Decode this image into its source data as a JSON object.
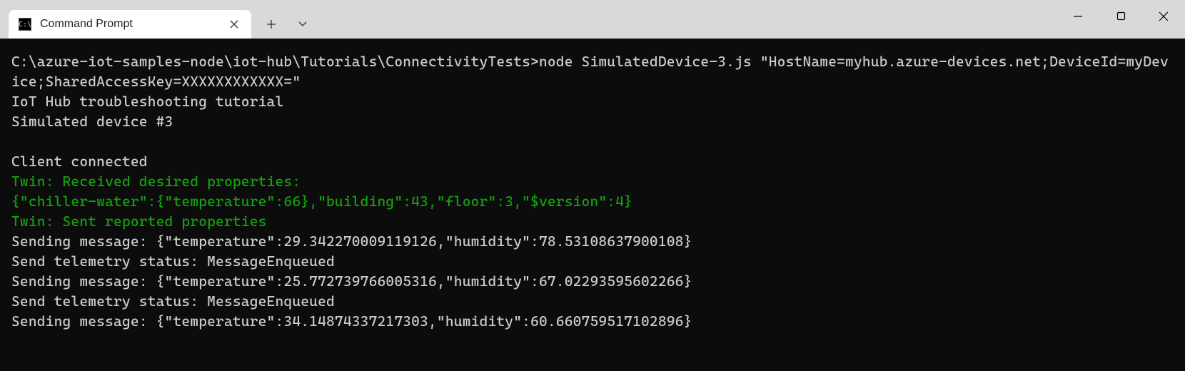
{
  "window": {
    "tab_title": "Command Prompt"
  },
  "terminal": {
    "command_line": "C:\\azure-iot-samples-node\\iot-hub\\Tutorials\\ConnectivityTests>node SimulatedDevice-3.js \"HostName=myhub.azure-devices.net;DeviceId=myDevice;SharedAccessKey=XXXXXXXXXXXX=\"",
    "line_tutorial": "IoT Hub troubleshooting tutorial",
    "line_sim": "Simulated device #3",
    "line_connected": "Client connected",
    "line_twin_recv": "Twin: Received desired properties:",
    "line_twin_json": "{\"chiller-water\":{\"temperature\":66},\"building\":43,\"floor\":3,\"$version\":4}",
    "line_twin_sent": "Twin: Sent reported properties",
    "line_send1": "Sending message: {\"temperature\":29.342270009119126,\"humidity\":78.53108637900108}",
    "line_status1": "Send telemetry status: MessageEnqueued",
    "line_send2": "Sending message: {\"temperature\":25.772739766005316,\"humidity\":67.02293595602266}",
    "line_status2": "Send telemetry status: MessageEnqueued",
    "line_send3": "Sending message: {\"temperature\":34.14874337217303,\"humidity\":60.660759517102896}"
  }
}
